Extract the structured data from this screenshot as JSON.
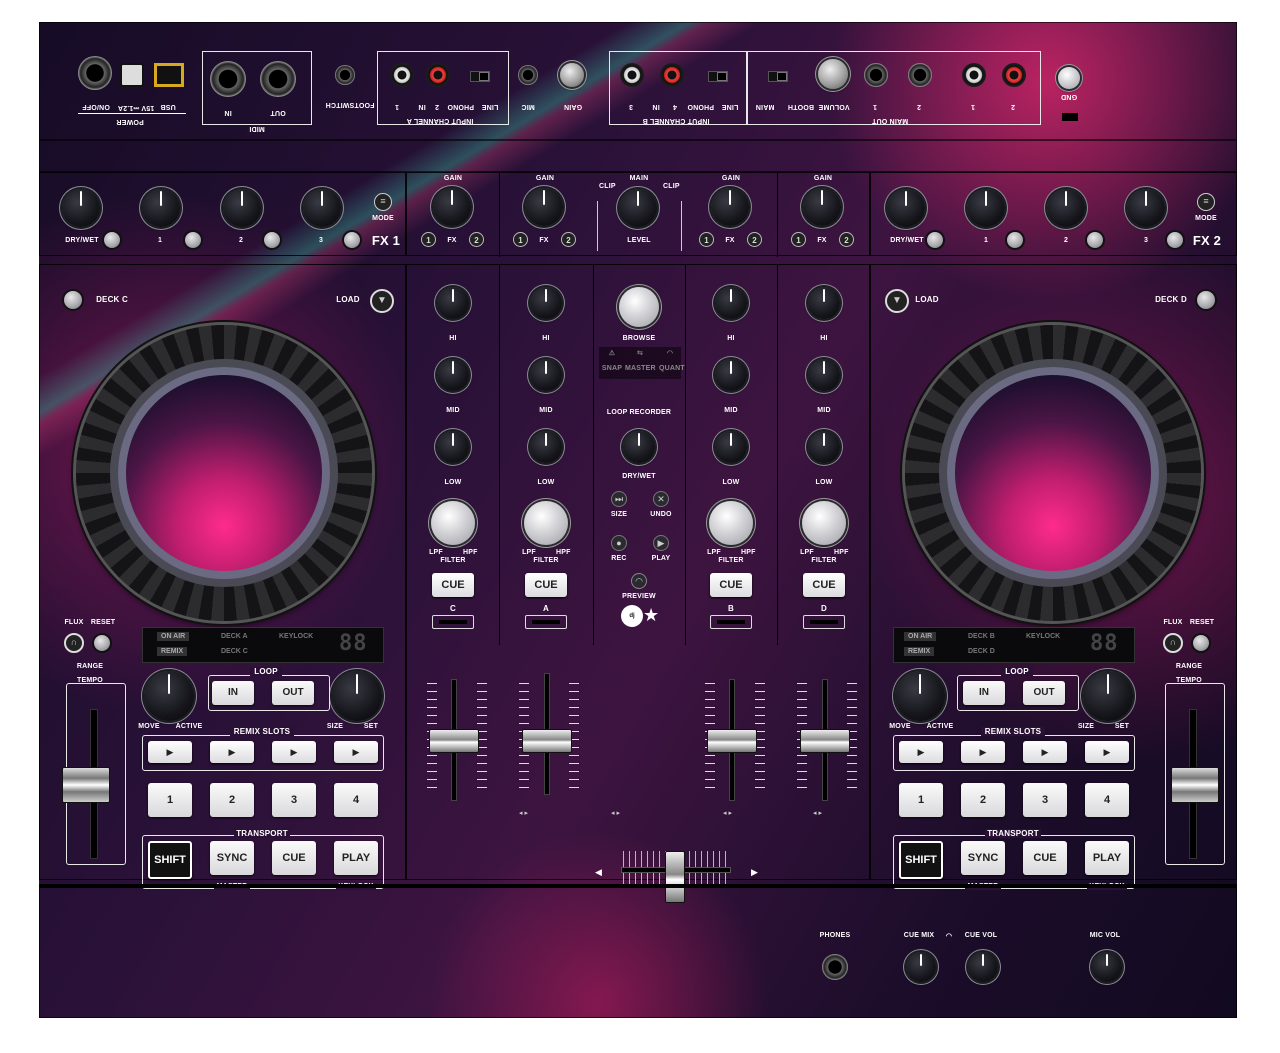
{
  "rear": {
    "power_label": "POWER",
    "usb_label": "USB",
    "dc_label": "15V ⎓1.2A",
    "onoff_label": "ON/OFF",
    "midi_label": "MIDI",
    "midi_in": "IN",
    "midi_out": "OUT",
    "footswitch_label": "FOOTSWITCH",
    "input_a_label": "INPUT CHANNEL A",
    "input_b_label": "INPUT CHANNEL B",
    "a_line": "LINE",
    "a_phono": "PHONO",
    "a_in1": "1",
    "a_in2": "2",
    "a_in": "IN",
    "b_line": "LINE",
    "b_phono": "PHONO",
    "b_in3": "3",
    "b_in4": "4",
    "b_in": "IN",
    "mic_label": "MIC",
    "gain_label": "GAIN",
    "main_out_label": "MAIN OUT",
    "main_label": "MAIN",
    "booth_label": "BOOTH",
    "volume_label": "VOLUME",
    "out_1": "1",
    "out_2": "2",
    "rca_1": "1",
    "rca_2": "2",
    "gnd_label": "GND"
  },
  "fx1": {
    "name": "FX 1",
    "drywet": "DRY/WET",
    "k1": "1",
    "k2": "2",
    "k3": "3",
    "mode": "MODE"
  },
  "fx2": {
    "name": "FX 2",
    "drywet": "DRY/WET",
    "k1": "1",
    "k2": "2",
    "k3": "3",
    "mode": "MODE"
  },
  "mixer_top": {
    "gain": "GAIN",
    "fx": "FX",
    "one": "1",
    "two": "2",
    "main": "MAIN",
    "clip": "CLIP",
    "level": "LEVEL"
  },
  "channels": [
    {
      "letter": "C",
      "hi": "HI",
      "mid": "MID",
      "low": "LOW",
      "filter": "FILTER",
      "lpf": "LPF",
      "hpf": "HPF",
      "cue": "CUE"
    },
    {
      "letter": "A",
      "hi": "HI",
      "mid": "MID",
      "low": "LOW",
      "filter": "FILTER",
      "lpf": "LPF",
      "hpf": "HPF",
      "cue": "CUE"
    },
    {
      "letter": "B",
      "hi": "HI",
      "mid": "MID",
      "low": "LOW",
      "filter": "FILTER",
      "lpf": "LPF",
      "hpf": "HPF",
      "cue": "CUE"
    },
    {
      "letter": "D",
      "hi": "HI",
      "mid": "MID",
      "low": "LOW",
      "filter": "FILTER",
      "lpf": "LPF",
      "hpf": "HPF",
      "cue": "CUE"
    }
  ],
  "center": {
    "browse": "BROWSE",
    "snap": "SNAP",
    "master": "MASTER",
    "quant": "QUANT",
    "loop_recorder": "LOOP RECORDER",
    "drywet": "DRY/WET",
    "size": "SIZE",
    "undo": "UNDO",
    "rec": "REC",
    "play": "PLAY",
    "preview": "PREVIEW",
    "logo": "dj skins"
  },
  "deck_left": {
    "deck": "DECK C",
    "load": "LOAD",
    "flux": "FLUX",
    "reset": "RESET",
    "range": "RANGE",
    "tempo": "TEMPO",
    "on_air": "ON AIR",
    "remix": "REMIX",
    "deck_a": "DECK A",
    "deck_c": "DECK C",
    "keylock": "KEYLOCK",
    "bpm": "88",
    "loop": "LOOP",
    "in": "IN",
    "out": "OUT",
    "move": "MOVE",
    "active": "ACTIVE",
    "size": "SIZE",
    "set": "SET",
    "remix_slots": "REMIX SLOTS",
    "pads": [
      "1",
      "2",
      "3",
      "4"
    ],
    "transport": "TRANSPORT",
    "shift": "SHIFT",
    "sync": "SYNC",
    "cue": "CUE",
    "play": "PLAY",
    "master": "MASTER",
    "keylock_bottom": "KEYLOCK"
  },
  "deck_right": {
    "deck": "DECK D",
    "load": "LOAD",
    "flux": "FLUX",
    "reset": "RESET",
    "range": "RANGE",
    "tempo": "TEMPO",
    "on_air": "ON AIR",
    "remix": "REMIX",
    "deck_a": "DECK B",
    "deck_c": "DECK D",
    "keylock": "KEYLOCK",
    "bpm": "88",
    "loop": "LOOP",
    "in": "IN",
    "out": "OUT",
    "move": "MOVE",
    "active": "ACTIVE",
    "size": "SIZE",
    "set": "SET",
    "remix_slots": "REMIX SLOTS",
    "pads": [
      "1",
      "2",
      "3",
      "4"
    ],
    "transport": "TRANSPORT",
    "shift": "SHIFT",
    "sync": "SYNC",
    "cue": "CUE",
    "play": "PLAY",
    "master": "MASTER",
    "keylock_bottom": "KEYLOCK"
  },
  "front": {
    "phones": "PHONES",
    "cue_mix": "CUE MIX",
    "cue_vol": "CUE VOL",
    "mic_vol": "MIC VOL"
  },
  "colors": {
    "accent_pink": "#ff2b8c",
    "accent_teal": "#3cc8aa",
    "base": "#1c0d2a"
  }
}
